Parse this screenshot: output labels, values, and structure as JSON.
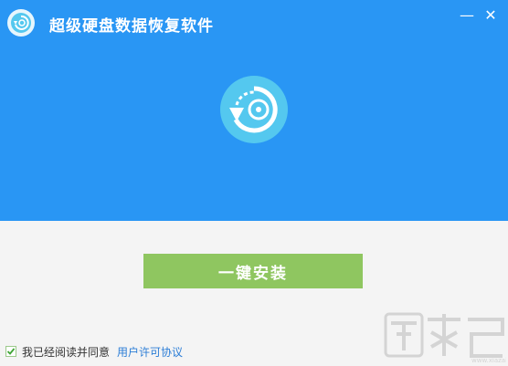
{
  "window": {
    "title": "超级硬盘数据恢复软件",
    "minimize_glyph": "—",
    "close_glyph": "✕"
  },
  "colors": {
    "header_bg": "#2996f4",
    "install_button": "#8fc660",
    "link": "#2b7dd6",
    "logo_circle": "#54c8ef"
  },
  "icons": {
    "app": "app-logo-icon",
    "main": "recovery-logo-icon",
    "check": "check-icon"
  },
  "main": {
    "install_label": "一键安装"
  },
  "footer": {
    "agreement_checked": true,
    "agreement_text": "我已经阅读并同意",
    "license_link": "用户许可协议"
  },
  "watermark": {
    "text": "下载吧"
  }
}
